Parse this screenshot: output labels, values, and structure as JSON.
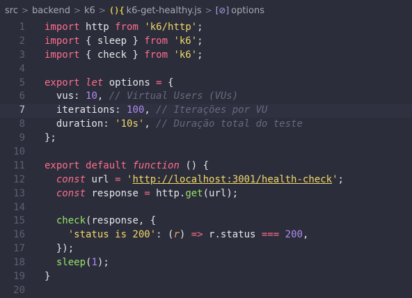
{
  "breadcrumb": {
    "items": [
      "src",
      "backend",
      "k6"
    ],
    "file_icon": "(){",
    "file": "k6-get-healthy.js",
    "symbol_icon": "[⊘]",
    "symbol": "options"
  },
  "lines": [
    {
      "n": "1",
      "tokens": [
        [
          "kw",
          "import"
        ],
        [
          "pn",
          " http "
        ],
        [
          "kw",
          "from"
        ],
        [
          "pn",
          " "
        ],
        [
          "str",
          "'k6/http'"
        ],
        [
          "pn",
          ";"
        ]
      ]
    },
    {
      "n": "2",
      "tokens": [
        [
          "kw",
          "import"
        ],
        [
          "pn",
          " { sleep } "
        ],
        [
          "kw",
          "from"
        ],
        [
          "pn",
          " "
        ],
        [
          "str",
          "'k6'"
        ],
        [
          "pn",
          ";"
        ]
      ]
    },
    {
      "n": "3",
      "tokens": [
        [
          "kw",
          "import"
        ],
        [
          "pn",
          " { check } "
        ],
        [
          "kw",
          "from"
        ],
        [
          "pn",
          " "
        ],
        [
          "str",
          "'k6'"
        ],
        [
          "pn",
          ";"
        ]
      ]
    },
    {
      "n": "4",
      "tokens": []
    },
    {
      "n": "5",
      "tokens": [
        [
          "kw",
          "export"
        ],
        [
          "pn",
          " "
        ],
        [
          "kwi",
          "let"
        ],
        [
          "pn",
          " options "
        ],
        [
          "op",
          "="
        ],
        [
          "pn",
          " {"
        ]
      ]
    },
    {
      "n": "6",
      "tokens": [
        [
          "pn",
          "  vus: "
        ],
        [
          "num",
          "10"
        ],
        [
          "pn",
          ", "
        ],
        [
          "cm",
          "// Virtual Users (VUs)"
        ]
      ]
    },
    {
      "n": "7",
      "tokens": [
        [
          "pn",
          "  iterations: "
        ],
        [
          "num",
          "100"
        ],
        [
          "pn",
          ", "
        ],
        [
          "cm",
          "// Iterações por VU"
        ]
      ],
      "current": true
    },
    {
      "n": "8",
      "tokens": [
        [
          "pn",
          "  duration: "
        ],
        [
          "str",
          "'10s'"
        ],
        [
          "pn",
          ", "
        ],
        [
          "cm",
          "// Duração total do teste"
        ]
      ]
    },
    {
      "n": "9",
      "tokens": [
        [
          "pn",
          "};"
        ]
      ]
    },
    {
      "n": "10",
      "tokens": []
    },
    {
      "n": "11",
      "tokens": [
        [
          "kw",
          "export"
        ],
        [
          "pn",
          " "
        ],
        [
          "kw",
          "default"
        ],
        [
          "pn",
          " "
        ],
        [
          "kwi",
          "function"
        ],
        [
          "pn",
          " () {"
        ]
      ]
    },
    {
      "n": "12",
      "tokens": [
        [
          "pn",
          "  "
        ],
        [
          "kwi",
          "const"
        ],
        [
          "pn",
          " url "
        ],
        [
          "op",
          "="
        ],
        [
          "pn",
          " "
        ],
        [
          "str",
          "'"
        ],
        [
          "link",
          "http://localhost:3001/health-check"
        ],
        [
          "str",
          "'"
        ],
        [
          "pn",
          ";"
        ]
      ]
    },
    {
      "n": "13",
      "tokens": [
        [
          "pn",
          "  "
        ],
        [
          "kwi",
          "const"
        ],
        [
          "pn",
          " response "
        ],
        [
          "op",
          "="
        ],
        [
          "pn",
          " http."
        ],
        [
          "fn",
          "get"
        ],
        [
          "pn",
          "(url);"
        ]
      ]
    },
    {
      "n": "14",
      "tokens": []
    },
    {
      "n": "15",
      "tokens": [
        [
          "pn",
          "  "
        ],
        [
          "fn",
          "check"
        ],
        [
          "pn",
          "(response, {"
        ]
      ]
    },
    {
      "n": "16",
      "tokens": [
        [
          "pn",
          "    "
        ],
        [
          "str",
          "'status is 200'"
        ],
        [
          "pn",
          ": ("
        ],
        [
          "param",
          "r"
        ],
        [
          "pn",
          ") "
        ],
        [
          "op",
          "=>"
        ],
        [
          "pn",
          " r.status "
        ],
        [
          "op",
          "==="
        ],
        [
          "pn",
          " "
        ],
        [
          "num",
          "200"
        ],
        [
          "pn",
          ","
        ]
      ]
    },
    {
      "n": "17",
      "tokens": [
        [
          "pn",
          "  });"
        ]
      ]
    },
    {
      "n": "18",
      "tokens": [
        [
          "pn",
          "  "
        ],
        [
          "fn",
          "sleep"
        ],
        [
          "pn",
          "("
        ],
        [
          "num",
          "1"
        ],
        [
          "pn",
          ");"
        ]
      ]
    },
    {
      "n": "19",
      "tokens": [
        [
          "pn",
          "}"
        ]
      ]
    },
    {
      "n": "20",
      "tokens": []
    }
  ],
  "colors": {
    "background": "#2b2d3a",
    "keyword": "#ff6e8e",
    "string": "#f3d86b",
    "number": "#b08cf0",
    "comment": "#676a80",
    "function": "#97e36a"
  }
}
